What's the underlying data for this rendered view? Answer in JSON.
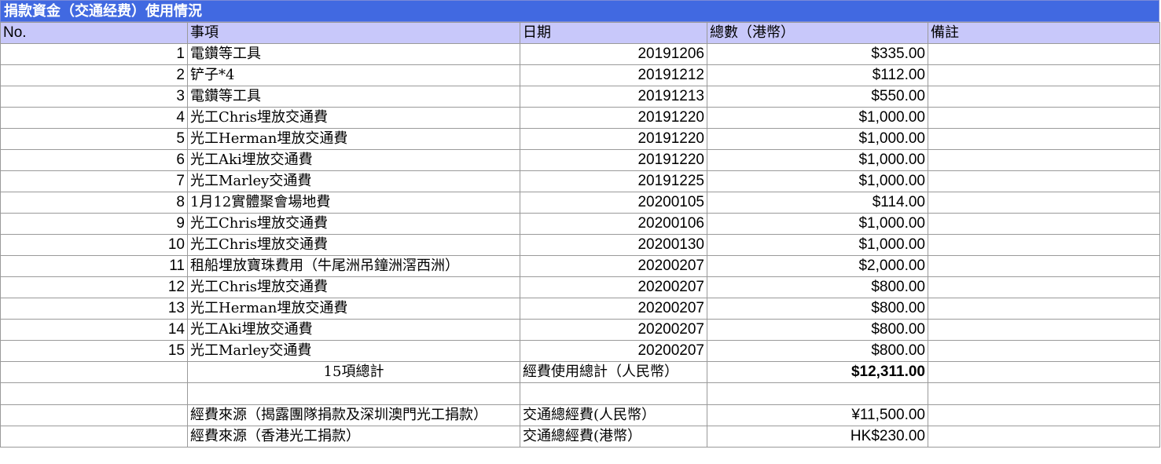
{
  "title": "捐款資金（交通经费）使用情況",
  "headers": [
    "No.",
    "事項",
    "日期",
    "總數（港幣）",
    "備註"
  ],
  "rows": [
    {
      "no": "1",
      "item": "電鑽等工具",
      "date": "20191206",
      "amount": "$335.00",
      "note": ""
    },
    {
      "no": "2",
      "item": "铲子*4",
      "date": "20191212",
      "amount": "$112.00",
      "note": ""
    },
    {
      "no": "3",
      "item": "電鑽等工具",
      "date": "20191213",
      "amount": "$550.00",
      "note": ""
    },
    {
      "no": "4",
      "item": "光工Chris埋放交通費",
      "date": "20191220",
      "amount": "$1,000.00",
      "note": ""
    },
    {
      "no": "5",
      "item": "光工Herman埋放交通費",
      "date": "20191220",
      "amount": "$1,000.00",
      "note": ""
    },
    {
      "no": "6",
      "item": "光工Aki埋放交通費",
      "date": "20191220",
      "amount": "$1,000.00",
      "note": ""
    },
    {
      "no": "7",
      "item": "光工Marley交通費",
      "date": "20191225",
      "amount": "$1,000.00",
      "note": ""
    },
    {
      "no": "8",
      "item": "1月12實體聚會場地費",
      "date": "20200105",
      "amount": "$114.00",
      "note": ""
    },
    {
      "no": "9",
      "item": "光工Chris埋放交通費",
      "date": "20200106",
      "amount": "$1,000.00",
      "note": ""
    },
    {
      "no": "10",
      "item": "光工Chris埋放交通費",
      "date": "20200130",
      "amount": "$1,000.00",
      "note": ""
    },
    {
      "no": "11",
      "item": "租船埋放寶珠費用（牛尾洲吊鐘洲滘西洲）",
      "date": "20200207",
      "amount": "$2,000.00",
      "note": ""
    },
    {
      "no": "12",
      "item": "光工Chris埋放交通費",
      "date": "20200207",
      "amount": "$800.00",
      "note": ""
    },
    {
      "no": "13",
      "item": "光工Herman埋放交通費",
      "date": "20200207",
      "amount": "$800.00",
      "note": ""
    },
    {
      "no": "14",
      "item": "光工Aki埋放交通費",
      "date": "20200207",
      "amount": "$800.00",
      "note": ""
    },
    {
      "no": "15",
      "item": "光工Marley交通費",
      "date": "20200207",
      "amount": "$800.00",
      "note": ""
    }
  ],
  "total": {
    "count_label": "15項總計",
    "label": "經費使用總計（人民幣）",
    "amount": "$12,311.00"
  },
  "sources": [
    {
      "source": "經費來源（揭露團隊捐款及深圳澳門光工捐款）",
      "label": "交通總經費(人民幣）",
      "amount": "¥11,500.00"
    },
    {
      "source": "經費來源（香港光工捐款）",
      "label": "交通總經費(港幣）",
      "amount": "HK$230.00"
    }
  ]
}
